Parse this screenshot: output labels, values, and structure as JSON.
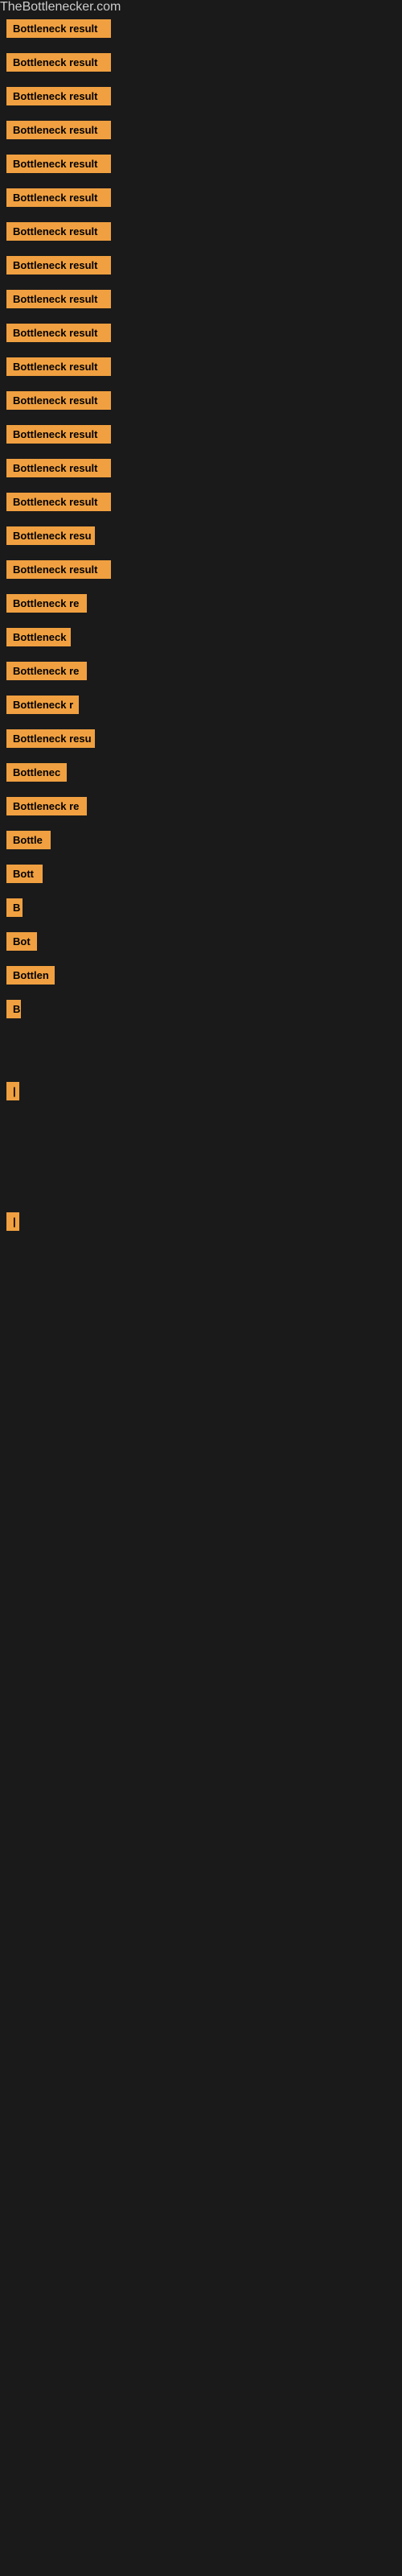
{
  "site": {
    "title": "TheBottlenecker.com"
  },
  "items": [
    {
      "label": "Bottleneck result",
      "width": 130
    },
    {
      "label": "Bottleneck result",
      "width": 130
    },
    {
      "label": "Bottleneck result",
      "width": 130
    },
    {
      "label": "Bottleneck result",
      "width": 130
    },
    {
      "label": "Bottleneck result",
      "width": 130
    },
    {
      "label": "Bottleneck result",
      "width": 130
    },
    {
      "label": "Bottleneck result",
      "width": 130
    },
    {
      "label": "Bottleneck result",
      "width": 130
    },
    {
      "label": "Bottleneck result",
      "width": 130
    },
    {
      "label": "Bottleneck result",
      "width": 130
    },
    {
      "label": "Bottleneck result",
      "width": 130
    },
    {
      "label": "Bottleneck result",
      "width": 130
    },
    {
      "label": "Bottleneck result",
      "width": 130
    },
    {
      "label": "Bottleneck result",
      "width": 130
    },
    {
      "label": "Bottleneck result",
      "width": 130
    },
    {
      "label": "Bottleneck resu",
      "width": 110
    },
    {
      "label": "Bottleneck result",
      "width": 130
    },
    {
      "label": "Bottleneck re",
      "width": 100
    },
    {
      "label": "Bottleneck",
      "width": 80
    },
    {
      "label": "Bottleneck re",
      "width": 100
    },
    {
      "label": "Bottleneck r",
      "width": 90
    },
    {
      "label": "Bottleneck resu",
      "width": 110
    },
    {
      "label": "Bottlenec",
      "width": 75
    },
    {
      "label": "Bottleneck re",
      "width": 100
    },
    {
      "label": "Bottle",
      "width": 55
    },
    {
      "label": "Bott",
      "width": 45
    },
    {
      "label": "B",
      "width": 20
    },
    {
      "label": "Bot",
      "width": 38
    },
    {
      "label": "Bottlen",
      "width": 60
    },
    {
      "label": "B",
      "width": 18
    },
    {
      "label": "",
      "width": 0
    },
    {
      "label": "",
      "width": 0
    },
    {
      "label": "|",
      "width": 10
    },
    {
      "label": "",
      "width": 0
    },
    {
      "label": "",
      "width": 0
    },
    {
      "label": "",
      "width": 0
    },
    {
      "label": "",
      "width": 0
    },
    {
      "label": "|",
      "width": 10
    }
  ]
}
